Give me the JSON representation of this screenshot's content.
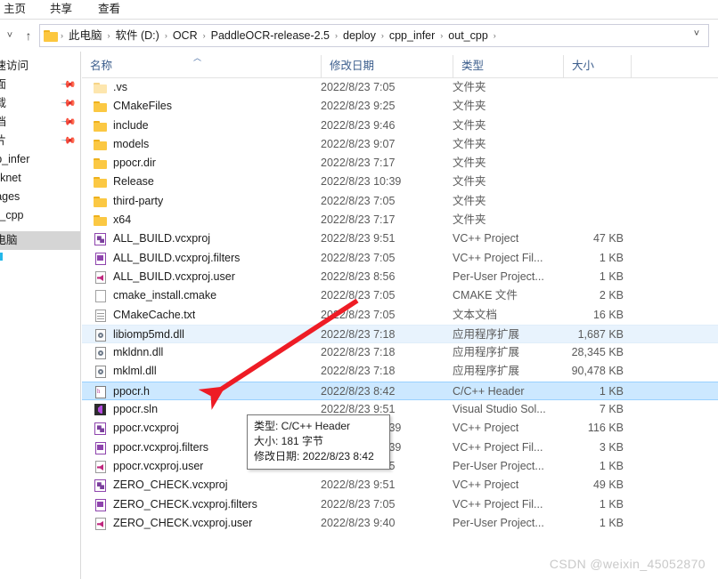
{
  "ribbon": {
    "tabs": [
      {
        "id": "home",
        "label": "主页"
      },
      {
        "id": "share",
        "label": "共享"
      },
      {
        "id": "view",
        "label": "查看"
      }
    ]
  },
  "address_bar": {
    "recent_locations_glyph": "˅",
    "up_glyph": "↑",
    "dropdown_glyph": "˅",
    "separator": "›",
    "crumbs": [
      "此电脑",
      "软件 (D:)",
      "OCR",
      "PaddleOCR-release-2.5",
      "deploy",
      "cpp_infer",
      "out_cpp"
    ]
  },
  "sidebar": {
    "items": [
      {
        "label": "快速访问",
        "pinned": false,
        "selected": false
      },
      {
        "label": "桌面",
        "pinned": true,
        "selected": false
      },
      {
        "label": "下载",
        "pinned": true,
        "selected": false
      },
      {
        "label": "文档",
        "pinned": true,
        "selected": false
      },
      {
        "label": "图片",
        "pinned": true,
        "selected": false
      },
      {
        "label": "cpp_infer",
        "pinned": false,
        "selected": false
      },
      {
        "label": "darknet",
        "pinned": false,
        "selected": false
      },
      {
        "label": "images",
        "pinned": false,
        "selected": false
      },
      {
        "label": "out_cpp",
        "pinned": false,
        "selected": false
      },
      {
        "label": "此电脑",
        "pinned": false,
        "selected": true
      }
    ],
    "pin_glyph": "📌"
  },
  "file_list": {
    "columns": {
      "name": "名称",
      "date": "修改日期",
      "type": "类型",
      "size": "大小"
    },
    "sort_arrow": "︿",
    "rows": [
      {
        "icon": "folder-pale",
        "name": ".vs",
        "date": "2022/8/23 7:05",
        "type": "文件夹",
        "size": "",
        "state": "normal"
      },
      {
        "icon": "folder",
        "name": "CMakeFiles",
        "date": "2022/8/23 9:25",
        "type": "文件夹",
        "size": "",
        "state": "normal"
      },
      {
        "icon": "folder",
        "name": "include",
        "date": "2022/8/23 9:46",
        "type": "文件夹",
        "size": "",
        "state": "normal"
      },
      {
        "icon": "folder",
        "name": "models",
        "date": "2022/8/23 9:07",
        "type": "文件夹",
        "size": "",
        "state": "normal"
      },
      {
        "icon": "folder",
        "name": "ppocr.dir",
        "date": "2022/8/23 7:17",
        "type": "文件夹",
        "size": "",
        "state": "normal"
      },
      {
        "icon": "folder",
        "name": "Release",
        "date": "2022/8/23 10:39",
        "type": "文件夹",
        "size": "",
        "state": "normal"
      },
      {
        "icon": "folder",
        "name": "third-party",
        "date": "2022/8/23 7:05",
        "type": "文件夹",
        "size": "",
        "state": "normal"
      },
      {
        "icon": "folder",
        "name": "x64",
        "date": "2022/8/23 7:17",
        "type": "文件夹",
        "size": "",
        "state": "normal"
      },
      {
        "icon": "vcxproj",
        "name": "ALL_BUILD.vcxproj",
        "date": "2022/8/23 9:51",
        "type": "VC++ Project",
        "size": "47 KB",
        "state": "normal"
      },
      {
        "icon": "filters",
        "name": "ALL_BUILD.vcxproj.filters",
        "date": "2022/8/23 7:05",
        "type": "VC++ Project Fil...",
        "size": "1 KB",
        "state": "normal"
      },
      {
        "icon": "user",
        "name": "ALL_BUILD.vcxproj.user",
        "date": "2022/8/23 8:56",
        "type": "Per-User Project...",
        "size": "1 KB",
        "state": "normal"
      },
      {
        "icon": "blank",
        "name": "cmake_install.cmake",
        "date": "2022/8/23 7:05",
        "type": "CMAKE 文件",
        "size": "2 KB",
        "state": "normal"
      },
      {
        "icon": "txt",
        "name": "CMakeCache.txt",
        "date": "2022/8/23 7:05",
        "type": "文本文档",
        "size": "16 KB",
        "state": "normal"
      },
      {
        "icon": "dll",
        "name": "libiomp5md.dll",
        "date": "2022/8/23 7:18",
        "type": "应用程序扩展",
        "size": "1,687 KB",
        "state": "hovered"
      },
      {
        "icon": "dll",
        "name": "mkldnn.dll",
        "date": "2022/8/23 7:18",
        "type": "应用程序扩展",
        "size": "28,345 KB",
        "state": "normal"
      },
      {
        "icon": "dll",
        "name": "mklml.dll",
        "date": "2022/8/23 7:18",
        "type": "应用程序扩展",
        "size": "90,478 KB",
        "state": "normal"
      },
      {
        "icon": "header",
        "name": "ppocr.h",
        "date": "2022/8/23 8:42",
        "type": "C/C++ Header",
        "size": "1 KB",
        "state": "selected"
      },
      {
        "icon": "sln",
        "name": "ppocr.sln",
        "date": "2022/8/23 9:51",
        "type": "Visual Studio Sol...",
        "size": "7 KB",
        "state": "normal"
      },
      {
        "icon": "vcxproj",
        "name": "ppocr.vcxproj",
        "date": "2022/8/23 10:39",
        "type": "VC++ Project",
        "size": "116 KB",
        "state": "normal"
      },
      {
        "icon": "filters",
        "name": "ppocr.vcxproj.filters",
        "date": "2022/8/23 10:39",
        "type": "VC++ Project Fil...",
        "size": "3 KB",
        "state": "normal"
      },
      {
        "icon": "user",
        "name": "ppocr.vcxproj.user",
        "date": "2022/8/23 7:15",
        "type": "Per-User Project...",
        "size": "1 KB",
        "state": "normal"
      },
      {
        "icon": "vcxproj",
        "name": "ZERO_CHECK.vcxproj",
        "date": "2022/8/23 9:51",
        "type": "VC++ Project",
        "size": "49 KB",
        "state": "normal"
      },
      {
        "icon": "filters",
        "name": "ZERO_CHECK.vcxproj.filters",
        "date": "2022/8/23 7:05",
        "type": "VC++ Project Fil...",
        "size": "1 KB",
        "state": "normal"
      },
      {
        "icon": "user",
        "name": "ZERO_CHECK.vcxproj.user",
        "date": "2022/8/23 9:40",
        "type": "Per-User Project...",
        "size": "1 KB",
        "state": "normal"
      }
    ]
  },
  "tooltip": {
    "type_line": "类型: C/C++ Header",
    "size_line": "大小: 181 字节",
    "date_line": "修改日期: 2022/8/23 8:42"
  },
  "annotation": {
    "arrow_color": "#ee1c25"
  },
  "watermark": {
    "text": "CSDN @weixin_45052870"
  }
}
